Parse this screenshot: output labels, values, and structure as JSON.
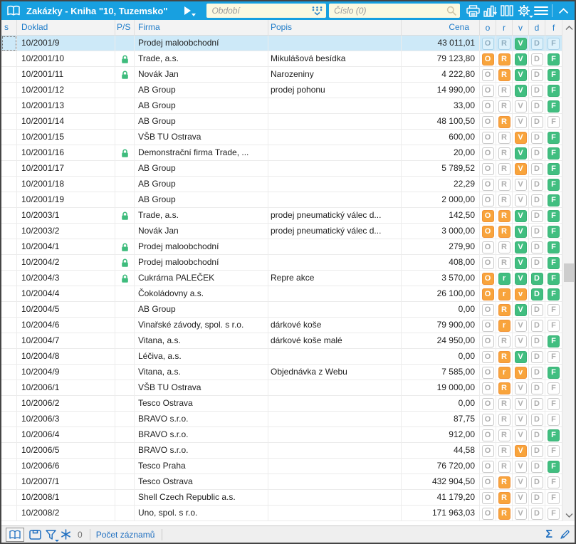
{
  "toolbar": {
    "title": "Zakázky - Kniha \"10, Tuzemsko\"",
    "period_placeholder": "Období",
    "search_placeholder": "Číslo (0)"
  },
  "columns": {
    "s": "s",
    "doklad": "Doklad",
    "ps": "P/S",
    "firma": "Firma",
    "popis": "Popis",
    "cena": "Cena"
  },
  "badge_columns": [
    "o",
    "r",
    "v",
    "d",
    "f"
  ],
  "rows": [
    {
      "doklad": "10/2001/9",
      "lock": false,
      "firma": "Prodej maloobchodní",
      "popis": "",
      "cena": "43 011,01",
      "selected": true,
      "badges": [
        [
          "O",
          "off"
        ],
        [
          "R",
          "off"
        ],
        [
          "V",
          "green"
        ],
        [
          "D",
          "off"
        ],
        [
          "F",
          "off"
        ]
      ]
    },
    {
      "doklad": "10/2001/10",
      "lock": true,
      "firma": "Trade, a.s.",
      "popis": "Mikulášová besídka",
      "cena": "79 123,80",
      "badges": [
        [
          "O",
          "orange"
        ],
        [
          "R",
          "orange"
        ],
        [
          "V",
          "green"
        ],
        [
          "D",
          "off"
        ],
        [
          "F",
          "green"
        ]
      ]
    },
    {
      "doklad": "10/2001/11",
      "lock": true,
      "firma": "Novák Jan",
      "popis": "Narozeniny",
      "cena": "4 222,80",
      "badges": [
        [
          "O",
          "off"
        ],
        [
          "R",
          "orange"
        ],
        [
          "V",
          "green"
        ],
        [
          "D",
          "off"
        ],
        [
          "F",
          "green"
        ]
      ]
    },
    {
      "doklad": "10/2001/12",
      "lock": false,
      "firma": "AB Group",
      "popis": "prodej pohonu",
      "cena": "14 990,00",
      "badges": [
        [
          "O",
          "off"
        ],
        [
          "R",
          "off"
        ],
        [
          "V",
          "green"
        ],
        [
          "D",
          "off"
        ],
        [
          "F",
          "green"
        ]
      ]
    },
    {
      "doklad": "10/2001/13",
      "lock": false,
      "firma": "AB Group",
      "popis": "",
      "cena": "33,00",
      "badges": [
        [
          "O",
          "off"
        ],
        [
          "R",
          "off"
        ],
        [
          "V",
          "off"
        ],
        [
          "D",
          "off"
        ],
        [
          "F",
          "green"
        ]
      ]
    },
    {
      "doklad": "10/2001/14",
      "lock": false,
      "firma": "AB Group",
      "popis": "",
      "cena": "48 100,50",
      "badges": [
        [
          "O",
          "off"
        ],
        [
          "R",
          "orange"
        ],
        [
          "V",
          "off"
        ],
        [
          "D",
          "off"
        ],
        [
          "F",
          "off"
        ]
      ]
    },
    {
      "doklad": "10/2001/15",
      "lock": false,
      "firma": "VŠB TU Ostrava",
      "popis": "",
      "cena": "600,00",
      "badges": [
        [
          "O",
          "off"
        ],
        [
          "R",
          "off"
        ],
        [
          "V",
          "orange"
        ],
        [
          "D",
          "off"
        ],
        [
          "F",
          "green"
        ]
      ]
    },
    {
      "doklad": "10/2001/16",
      "lock": true,
      "firma": "Demonstrační firma Trade, ...",
      "popis": "",
      "cena": "20,00",
      "badges": [
        [
          "O",
          "off"
        ],
        [
          "R",
          "off"
        ],
        [
          "V",
          "green"
        ],
        [
          "D",
          "off"
        ],
        [
          "F",
          "green"
        ]
      ]
    },
    {
      "doklad": "10/2001/17",
      "lock": false,
      "firma": "AB Group",
      "popis": "",
      "cena": "5 789,52",
      "badges": [
        [
          "O",
          "off"
        ],
        [
          "R",
          "off"
        ],
        [
          "V",
          "orange"
        ],
        [
          "D",
          "off"
        ],
        [
          "F",
          "green"
        ]
      ]
    },
    {
      "doklad": "10/2001/18",
      "lock": false,
      "firma": "AB Group",
      "popis": "",
      "cena": "22,29",
      "badges": [
        [
          "O",
          "off"
        ],
        [
          "R",
          "off"
        ],
        [
          "V",
          "off"
        ],
        [
          "D",
          "off"
        ],
        [
          "F",
          "green"
        ]
      ]
    },
    {
      "doklad": "10/2001/19",
      "lock": false,
      "firma": "AB Group",
      "popis": "",
      "cena": "2 000,00",
      "badges": [
        [
          "O",
          "off"
        ],
        [
          "R",
          "off"
        ],
        [
          "V",
          "off"
        ],
        [
          "D",
          "off"
        ],
        [
          "F",
          "green"
        ]
      ]
    },
    {
      "doklad": "10/2003/1",
      "lock": true,
      "firma": "Trade, a.s.",
      "popis": "prodej pneumatický válec d...",
      "cena": "142,50",
      "badges": [
        [
          "O",
          "orange"
        ],
        [
          "R",
          "orange"
        ],
        [
          "V",
          "green"
        ],
        [
          "D",
          "off"
        ],
        [
          "F",
          "green"
        ]
      ]
    },
    {
      "doklad": "10/2003/2",
      "lock": false,
      "firma": "Novák Jan",
      "popis": "prodej pneumatický válec d...",
      "cena": "3 000,00",
      "badges": [
        [
          "O",
          "orange"
        ],
        [
          "R",
          "orange"
        ],
        [
          "V",
          "green"
        ],
        [
          "D",
          "off"
        ],
        [
          "F",
          "green"
        ]
      ]
    },
    {
      "doklad": "10/2004/1",
      "lock": true,
      "firma": "Prodej maloobchodní",
      "popis": "",
      "cena": "279,90",
      "badges": [
        [
          "O",
          "off"
        ],
        [
          "R",
          "off"
        ],
        [
          "V",
          "green"
        ],
        [
          "D",
          "off"
        ],
        [
          "F",
          "green"
        ]
      ]
    },
    {
      "doklad": "10/2004/2",
      "lock": true,
      "firma": "Prodej maloobchodní",
      "popis": "",
      "cena": "408,00",
      "badges": [
        [
          "O",
          "off"
        ],
        [
          "R",
          "off"
        ],
        [
          "V",
          "green"
        ],
        [
          "D",
          "off"
        ],
        [
          "F",
          "green"
        ]
      ]
    },
    {
      "doklad": "10/2004/3",
      "lock": true,
      "firma": "Cukrárna PALEČEK",
      "popis": "Repre akce",
      "cena": "3 570,00",
      "badges": [
        [
          "O",
          "orange"
        ],
        [
          "r",
          "green"
        ],
        [
          "V",
          "green"
        ],
        [
          "D",
          "green"
        ],
        [
          "F",
          "green"
        ]
      ]
    },
    {
      "doklad": "10/2004/4",
      "lock": false,
      "firma": "Čokoládovny a.s.",
      "popis": "",
      "cena": "26 100,00",
      "badges": [
        [
          "O",
          "orange"
        ],
        [
          "r",
          "orange"
        ],
        [
          "v",
          "orange"
        ],
        [
          "D",
          "green"
        ],
        [
          "F",
          "green"
        ]
      ]
    },
    {
      "doklad": "10/2004/5",
      "lock": false,
      "firma": "AB Group",
      "popis": "",
      "cena": "0,00",
      "badges": [
        [
          "O",
          "off"
        ],
        [
          "R",
          "orange"
        ],
        [
          "V",
          "green"
        ],
        [
          "D",
          "off"
        ],
        [
          "F",
          "off"
        ]
      ]
    },
    {
      "doklad": "10/2004/6",
      "lock": false,
      "firma": "Vinařské závody, spol. s r.o.",
      "popis": "dárkové koše",
      "cena": "79 900,00",
      "badges": [
        [
          "O",
          "off"
        ],
        [
          "r",
          "orange"
        ],
        [
          "V",
          "off"
        ],
        [
          "D",
          "off"
        ],
        [
          "F",
          "off"
        ]
      ]
    },
    {
      "doklad": "10/2004/7",
      "lock": false,
      "firma": "Vitana, a.s.",
      "popis": "dárkové koše malé",
      "cena": "24 950,00",
      "badges": [
        [
          "O",
          "off"
        ],
        [
          "R",
          "off"
        ],
        [
          "V",
          "off"
        ],
        [
          "D",
          "off"
        ],
        [
          "F",
          "green"
        ]
      ]
    },
    {
      "doklad": "10/2004/8",
      "lock": false,
      "firma": "Léčiva, a.s.",
      "popis": "",
      "cena": "0,00",
      "badges": [
        [
          "O",
          "off"
        ],
        [
          "R",
          "orange"
        ],
        [
          "V",
          "green"
        ],
        [
          "D",
          "off"
        ],
        [
          "F",
          "off"
        ]
      ]
    },
    {
      "doklad": "10/2004/9",
      "lock": false,
      "firma": "Vitana, a.s.",
      "popis": "Objednávka z Webu",
      "cena": "7 585,00",
      "badges": [
        [
          "O",
          "off"
        ],
        [
          "r",
          "orange"
        ],
        [
          "v",
          "orange"
        ],
        [
          "D",
          "off"
        ],
        [
          "F",
          "green"
        ]
      ]
    },
    {
      "doklad": "10/2006/1",
      "lock": false,
      "firma": "VŠB TU Ostrava",
      "popis": "",
      "cena": "19 000,00",
      "badges": [
        [
          "O",
          "off"
        ],
        [
          "R",
          "orange"
        ],
        [
          "V",
          "off"
        ],
        [
          "D",
          "off"
        ],
        [
          "F",
          "off"
        ]
      ]
    },
    {
      "doklad": "10/2006/2",
      "lock": false,
      "firma": "Tesco Ostrava",
      "popis": "",
      "cena": "0,00",
      "badges": [
        [
          "O",
          "off"
        ],
        [
          "R",
          "off"
        ],
        [
          "V",
          "off"
        ],
        [
          "D",
          "off"
        ],
        [
          "F",
          "off"
        ]
      ]
    },
    {
      "doklad": "10/2006/3",
      "lock": false,
      "firma": "BRAVO s.r.o.",
      "popis": "",
      "cena": "87,75",
      "badges": [
        [
          "O",
          "off"
        ],
        [
          "R",
          "off"
        ],
        [
          "V",
          "off"
        ],
        [
          "D",
          "off"
        ],
        [
          "F",
          "off"
        ]
      ]
    },
    {
      "doklad": "10/2006/4",
      "lock": false,
      "firma": "BRAVO s.r.o.",
      "popis": "",
      "cena": "912,00",
      "badges": [
        [
          "O",
          "off"
        ],
        [
          "R",
          "off"
        ],
        [
          "V",
          "off"
        ],
        [
          "D",
          "off"
        ],
        [
          "F",
          "green"
        ]
      ]
    },
    {
      "doklad": "10/2006/5",
      "lock": false,
      "firma": "BRAVO s.r.o.",
      "popis": "",
      "cena": "44,58",
      "badges": [
        [
          "O",
          "off"
        ],
        [
          "R",
          "off"
        ],
        [
          "V",
          "orange"
        ],
        [
          "D",
          "off"
        ],
        [
          "F",
          "off"
        ]
      ]
    },
    {
      "doklad": "10/2006/6",
      "lock": false,
      "firma": "Tesco Praha",
      "popis": "",
      "cena": "76 720,00",
      "badges": [
        [
          "O",
          "off"
        ],
        [
          "R",
          "off"
        ],
        [
          "V",
          "off"
        ],
        [
          "D",
          "off"
        ],
        [
          "F",
          "green"
        ]
      ]
    },
    {
      "doklad": "10/2007/1",
      "lock": false,
      "firma": "Tesco Ostrava",
      "popis": "",
      "cena": "432 904,50",
      "badges": [
        [
          "O",
          "off"
        ],
        [
          "R",
          "orange"
        ],
        [
          "V",
          "off"
        ],
        [
          "D",
          "off"
        ],
        [
          "F",
          "off"
        ]
      ]
    },
    {
      "doklad": "10/2008/1",
      "lock": false,
      "firma": "Shell Czech Republic a.s.",
      "popis": "",
      "cena": "41 179,20",
      "badges": [
        [
          "O",
          "off"
        ],
        [
          "R",
          "orange"
        ],
        [
          "V",
          "off"
        ],
        [
          "D",
          "off"
        ],
        [
          "F",
          "off"
        ]
      ]
    },
    {
      "doklad": "10/2008/2",
      "lock": false,
      "firma": "Uno, spol. s r.o.",
      "popis": "",
      "cena": "171 963,03",
      "badges": [
        [
          "O",
          "off"
        ],
        [
          "R",
          "orange"
        ],
        [
          "V",
          "off"
        ],
        [
          "D",
          "off"
        ],
        [
          "F",
          "off"
        ]
      ]
    }
  ],
  "statusbar": {
    "count": "0",
    "records_label": "Počet záznamů"
  },
  "colors": {
    "titlebar_blue": "#18A0E0",
    "accent_blue": "#1F7CC9",
    "badge_orange": "#F8A43C",
    "badge_green": "#41BE80",
    "lock_green": "#3FBC7D",
    "selected_row": "#CDE9F8",
    "input_bg": "#FCF9E1"
  }
}
